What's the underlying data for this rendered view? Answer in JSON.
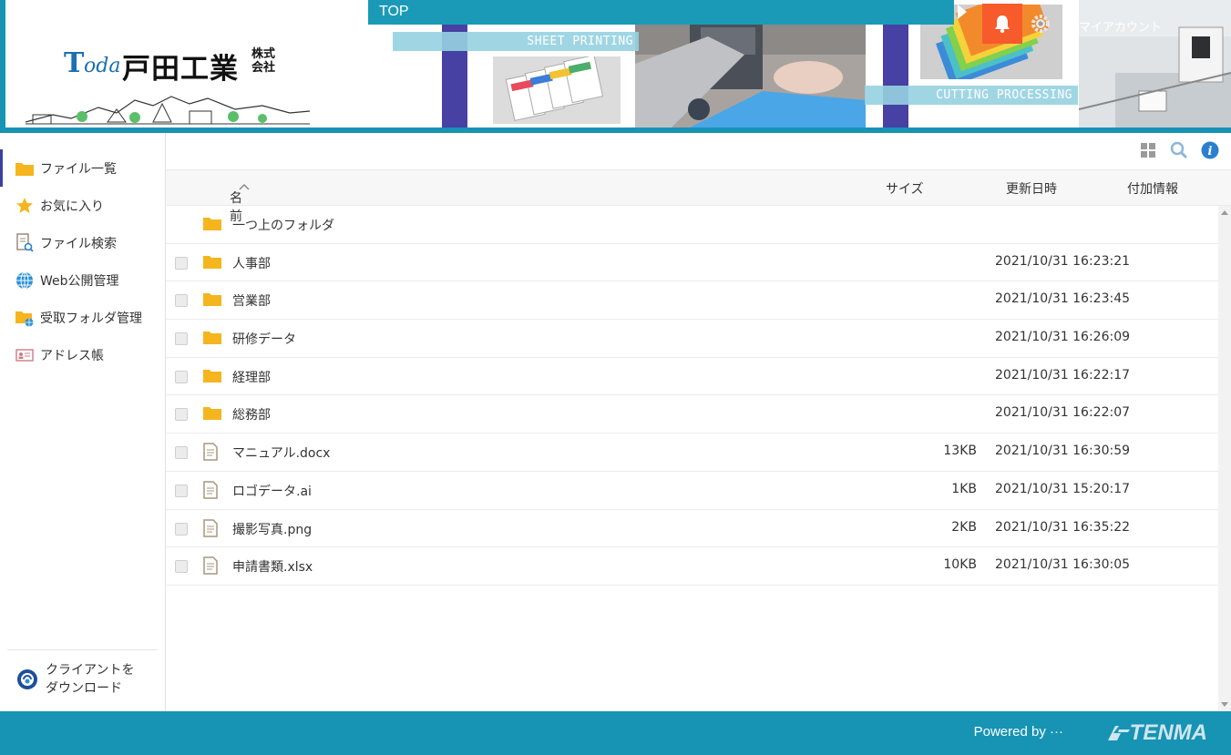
{
  "header": {
    "logo_latin": "oda",
    "logo_t": "T",
    "logo_japanese": "戸田工業",
    "logo_suffix": "株式会社",
    "top_label": "TOP",
    "sheet_printing": "SHEET PRINTING",
    "cutting_processing": "CUTTING PROCESSING",
    "account_label": "マイアカウント"
  },
  "sidebar": {
    "items": [
      {
        "label": "ファイル一覧",
        "icon": "folder-icon"
      },
      {
        "label": "お気に入り",
        "icon": "star-icon"
      },
      {
        "label": "ファイル検索",
        "icon": "file-search-icon"
      },
      {
        "label": "Web公開管理",
        "icon": "globe-icon"
      },
      {
        "label": "受取フォルダ管理",
        "icon": "folder-globe-icon"
      },
      {
        "label": "アドレス帳",
        "icon": "address-card-icon"
      }
    ],
    "download_client": "クライアントをダウンロード",
    "download_line1": "クライアントを",
    "download_line2": "ダウンロード"
  },
  "toolbar": {
    "icons": [
      "grid-view-icon",
      "search-icon",
      "info-icon"
    ]
  },
  "columns": {
    "name": "名前",
    "size": "サイズ",
    "modified": "更新日時",
    "extra": "付加情報"
  },
  "parent_folder": "一つ上のフォルダ",
  "files": [
    {
      "name": "人事部",
      "type": "folder",
      "size": "",
      "modified": "2021/10/31 16:23:21"
    },
    {
      "name": "営業部",
      "type": "folder",
      "size": "",
      "modified": "2021/10/31 16:23:45"
    },
    {
      "name": "研修データ",
      "type": "folder",
      "size": "",
      "modified": "2021/10/31 16:26:09"
    },
    {
      "name": "経理部",
      "type": "folder",
      "size": "",
      "modified": "2021/10/31 16:22:17"
    },
    {
      "name": "総務部",
      "type": "folder",
      "size": "",
      "modified": "2021/10/31 16:22:07"
    },
    {
      "name": "マニュアル.docx",
      "type": "file",
      "size": "13KB",
      "modified": "2021/10/31 16:30:59"
    },
    {
      "name": "ロゴデータ.ai",
      "type": "file",
      "size": "1KB",
      "modified": "2021/10/31 15:20:17"
    },
    {
      "name": "撮影写真.png",
      "type": "file",
      "size": "2KB",
      "modified": "2021/10/31 16:35:22"
    },
    {
      "name": "申請書類.xlsx",
      "type": "file",
      "size": "10KB",
      "modified": "2021/10/31 16:30:05"
    }
  ],
  "footer": {
    "powered_by": "Powered by ···",
    "brand": "TENMA"
  },
  "colors": {
    "accent": "#1793b4",
    "active_nav": "#3a3fa0",
    "folder": "#f5b51f",
    "bell_bg": "#f75a2b"
  }
}
